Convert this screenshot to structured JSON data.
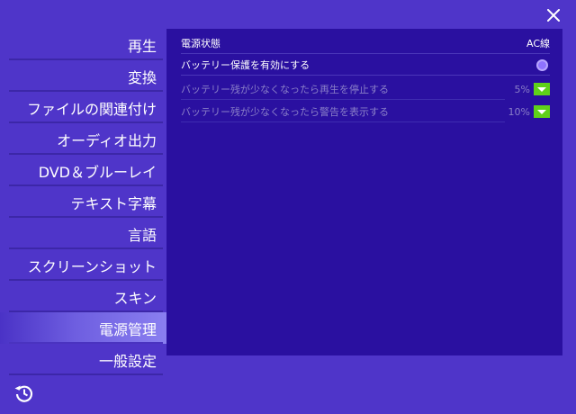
{
  "window": {
    "close_icon": "close-icon"
  },
  "sidebar": {
    "items": [
      {
        "label": "再生"
      },
      {
        "label": "変換"
      },
      {
        "label": "ファイルの関連付け"
      },
      {
        "label": "オーディオ出力"
      },
      {
        "label": "DVD＆ブルーレイ"
      },
      {
        "label": "テキスト字幕"
      },
      {
        "label": "言語"
      },
      {
        "label": "スクリーンショット"
      },
      {
        "label": "スキン"
      },
      {
        "label": "電源管理",
        "active": true
      },
      {
        "label": "一般設定"
      }
    ],
    "reset_icon": "history-reset-icon"
  },
  "power": {
    "status_label": "電源状態",
    "status_value": "AC線",
    "battery_protect_label": "バッテリー保護を有効にする",
    "battery_protect_enabled": true,
    "low_stop_label": "バッテリー残が少なくなったら再生を停止する",
    "low_stop_value": "5%",
    "low_warn_label": "バッテリー残が少なくなったら警告を表示する",
    "low_warn_value": "10%"
  },
  "colors": {
    "background": "#4f35c9",
    "panel": "#2a10a0",
    "accent_green": "#5fd11a",
    "toggle": "#8f72ff",
    "disabled_text": "#8a7fc8"
  }
}
